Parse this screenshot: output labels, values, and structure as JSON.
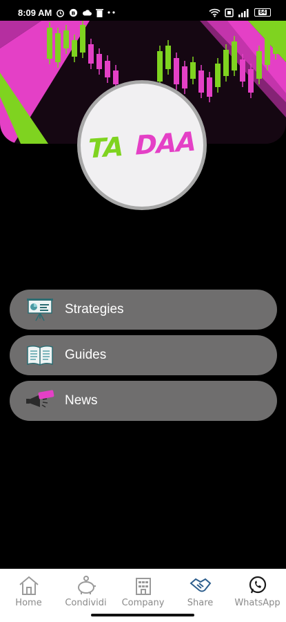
{
  "status_bar": {
    "time": "8:09 AM",
    "battery": "64"
  },
  "logo": {
    "part1": "TA",
    "part2": "DAA",
    "colors": {
      "ta": "#7fd320",
      "daa": "#e440c6"
    }
  },
  "menu": {
    "items": [
      {
        "label": "Strategies",
        "icon": "presentation-board-icon"
      },
      {
        "label": "Guides",
        "icon": "open-book-icon"
      },
      {
        "label": "News",
        "icon": "megaphone-latest-icon"
      }
    ]
  },
  "bottom_nav": {
    "items": [
      {
        "label": "Home",
        "icon": "house-icon"
      },
      {
        "label": "Condividi",
        "icon": "piggy-bank-icon"
      },
      {
        "label": "Company",
        "icon": "building-icon"
      },
      {
        "label": "Share",
        "icon": "handshake-icon"
      },
      {
        "label": "WhatsApp",
        "icon": "whatsapp-icon"
      }
    ]
  },
  "theme": {
    "background": "#000000",
    "menu_item": "#6f6e6e",
    "green": "#7fd320",
    "magenta": "#e440c6"
  }
}
